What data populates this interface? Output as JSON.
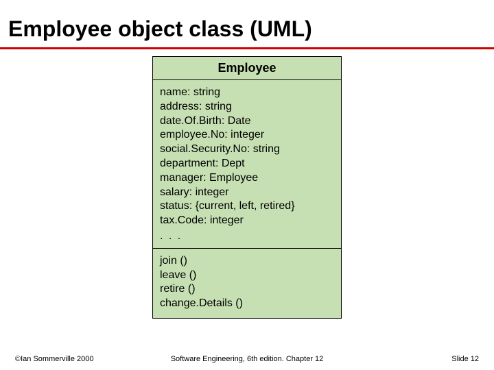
{
  "title": "Employee object class (UML)",
  "uml": {
    "class_name": "Employee",
    "attributes": [
      "name: string",
      "address: string",
      "date.Of.Birth: Date",
      "employee.No: integer",
      "social.Security.No: string",
      "department: Dept",
      "manager: Employee",
      "salary: integer",
      "status:  {current, left, retired}",
      "tax.Code: integer"
    ],
    "attr_ellipsis": ". . .",
    "operations": [
      "join ()",
      "leave ()",
      "retire ()",
      "change.Details ()"
    ]
  },
  "footer": {
    "left": "©Ian Sommerville 2000",
    "center": "Software Engineering, 6th edition. Chapter 12",
    "right": "Slide 12"
  }
}
